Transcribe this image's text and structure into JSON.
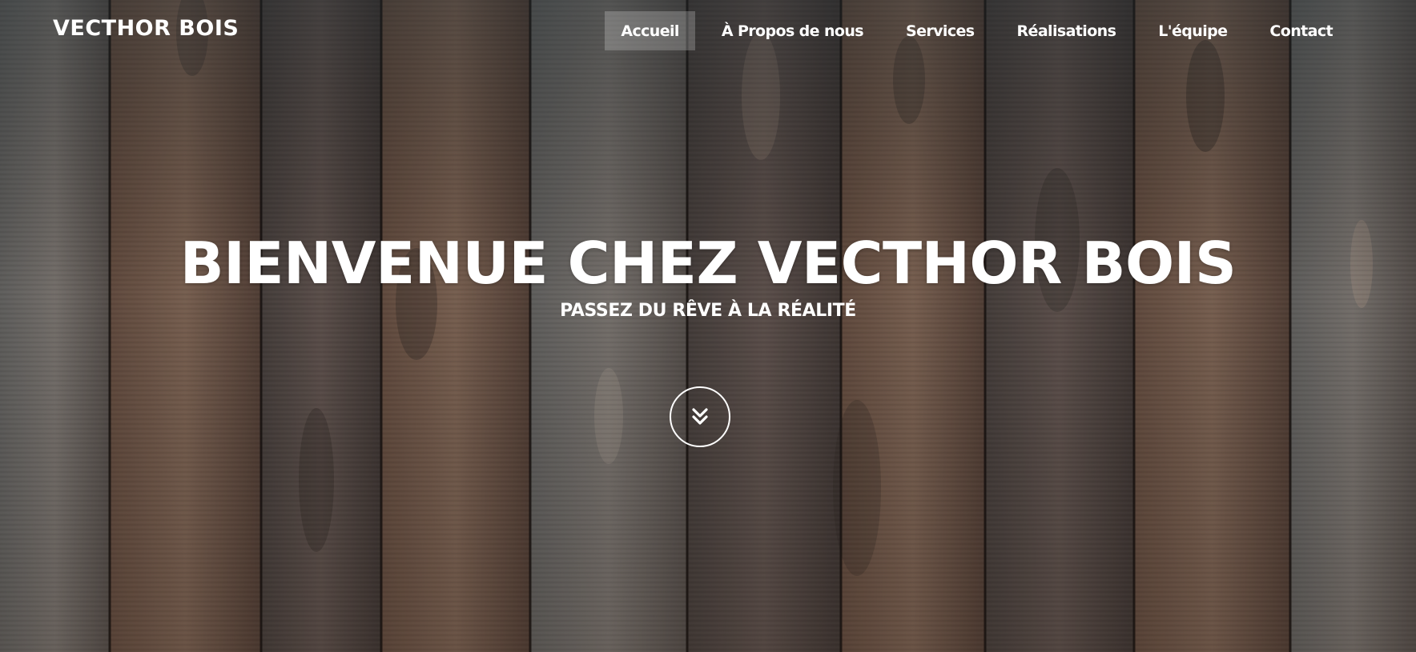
{
  "brand": {
    "name": "VECTHOR BOIS"
  },
  "nav": {
    "items": [
      {
        "label": "Accueil",
        "active": true
      },
      {
        "label": "À Propos de nous",
        "active": false
      },
      {
        "label": "Services",
        "active": false
      },
      {
        "label": "Réalisations",
        "active": false
      },
      {
        "label": "L'équipe",
        "active": false
      },
      {
        "label": "Contact",
        "active": false
      }
    ]
  },
  "hero": {
    "headline": "BIENVENUE CHEZ VECTHOR BOIS",
    "tagline": "PASSEZ DU RÊVE À LA RÉALITÉ",
    "scroll_icon": "double-chevron-down-icon"
  },
  "colors": {
    "text": "#ffffff",
    "wood_dark": "#3f3a38",
    "wood_mid": "#6b5446",
    "wood_light": "#8f7f76",
    "active_nav_bg": "rgba(255,255,255,0.22)"
  }
}
